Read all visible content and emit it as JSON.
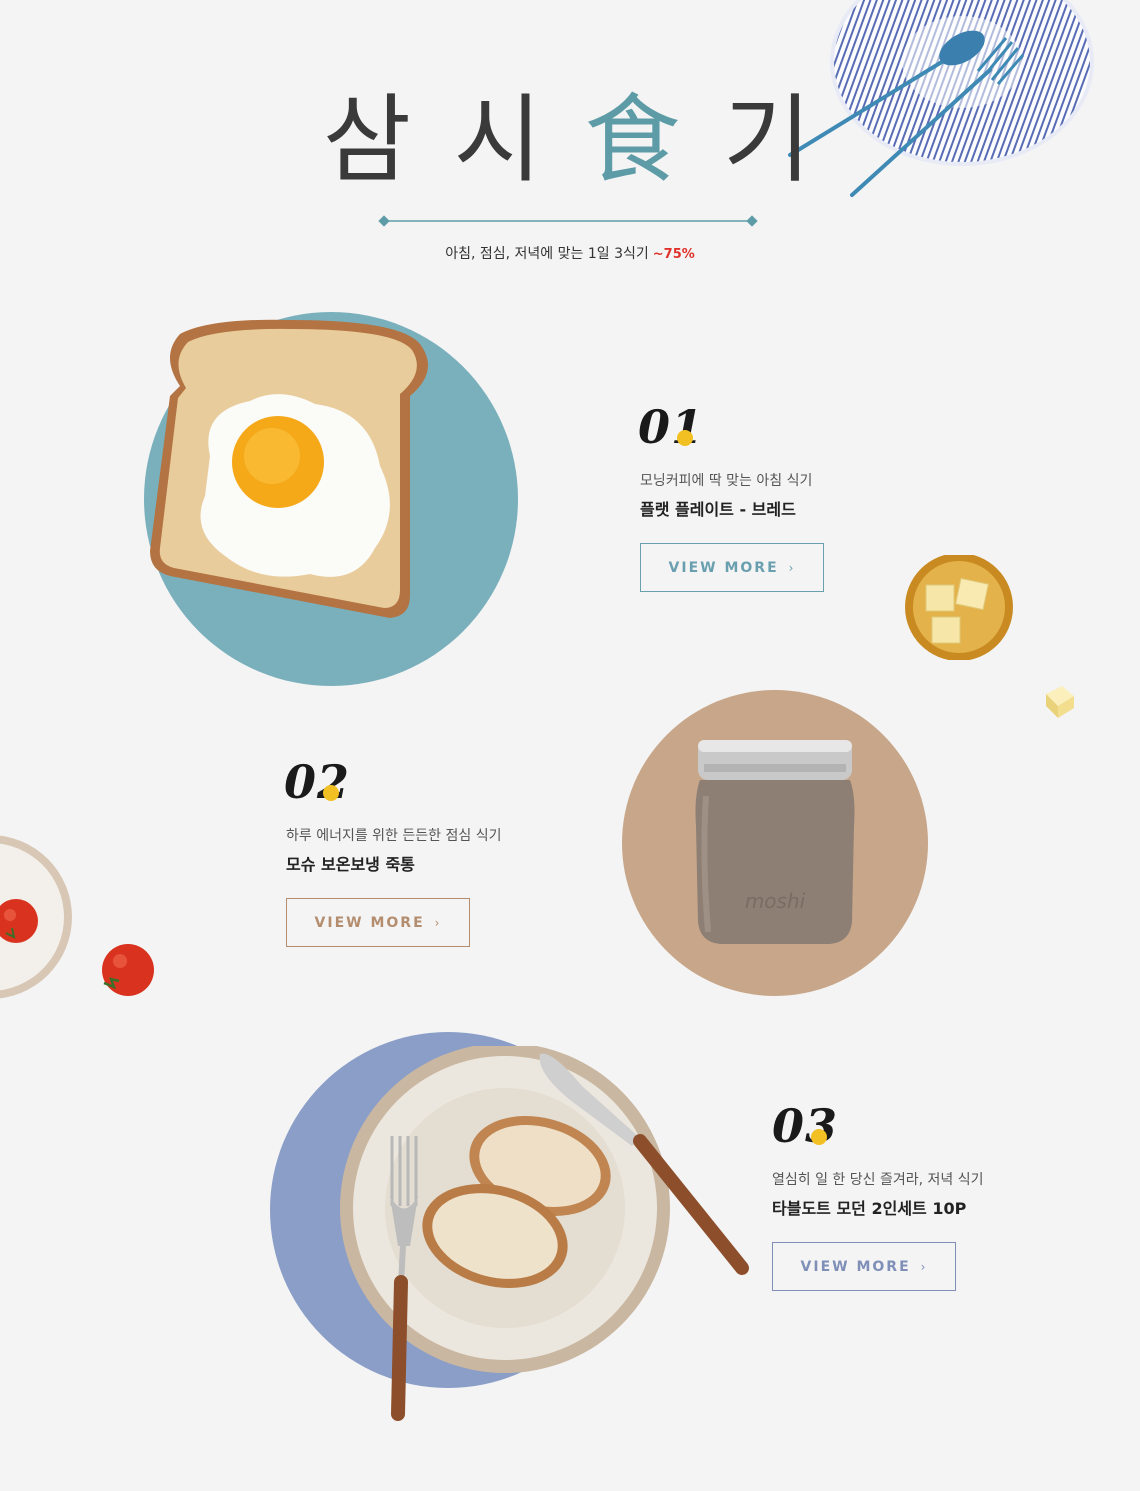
{
  "header": {
    "title_part1": "삼 시 ",
    "title_accent": "食",
    "title_part2": " 기",
    "subtitle": "아침, 점심, 저녁에 맞는 1일 3식기",
    "discount": "~75%"
  },
  "products": [
    {
      "number": "01",
      "description": "모닝커피에 딱 맞는 아침 식기",
      "name": "플랫 플레이트 - 브레드",
      "button_label": "VIEW MORE",
      "circle_color": "#7ab0bc",
      "button_color": "#6a9fb0"
    },
    {
      "number": "02",
      "description": "하루 에너지를 위한 든든한 점심 식기",
      "name": "모슈 보온보냉 죽통",
      "button_label": "VIEW MORE",
      "circle_color": "#c7a689",
      "button_color": "#b38d6e",
      "jar_brand": "moshi"
    },
    {
      "number": "03",
      "description": "열심히 일 한 당신 즐겨라, 저녁 식기",
      "name": "타블도트 모던 2인세트 10P",
      "button_label": "VIEW MORE",
      "circle_color": "#8a9ec7",
      "button_color": "#7f8fb8"
    }
  ],
  "icons": {
    "chevron": "chevron-right-icon"
  },
  "colors": {
    "background": "#f4f4f4",
    "accent_teal": "#5d9ca7",
    "discount_red": "#e0322b",
    "number_dot": "#f2c023"
  }
}
